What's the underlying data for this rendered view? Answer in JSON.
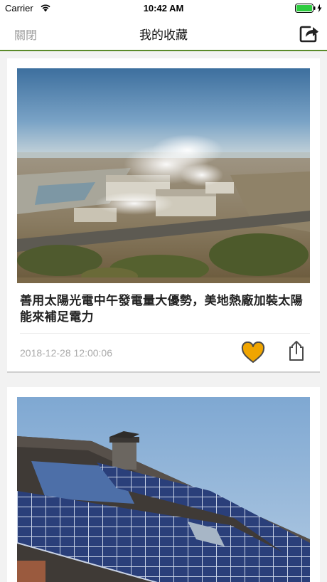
{
  "status_bar": {
    "carrier": "Carrier",
    "time": "10:42 AM",
    "icons": [
      "wifi-icon",
      "battery-icon",
      "charging-bolt-icon"
    ]
  },
  "nav": {
    "close_label": "關閉",
    "title": "我的收藏",
    "share_icon": "share-box-arrow-icon"
  },
  "accent_color": "#5b8a2a",
  "like_color": "#f0a500",
  "cards": [
    {
      "image": "geothermal-power-plant-photo",
      "title": "善用太陽光電中午發電量大優勢，美地熱廠加裝太陽能來補足電力",
      "date": "2018-12-28 12:00:06",
      "liked": true
    },
    {
      "image": "rooftop-solar-panels-photo"
    }
  ]
}
